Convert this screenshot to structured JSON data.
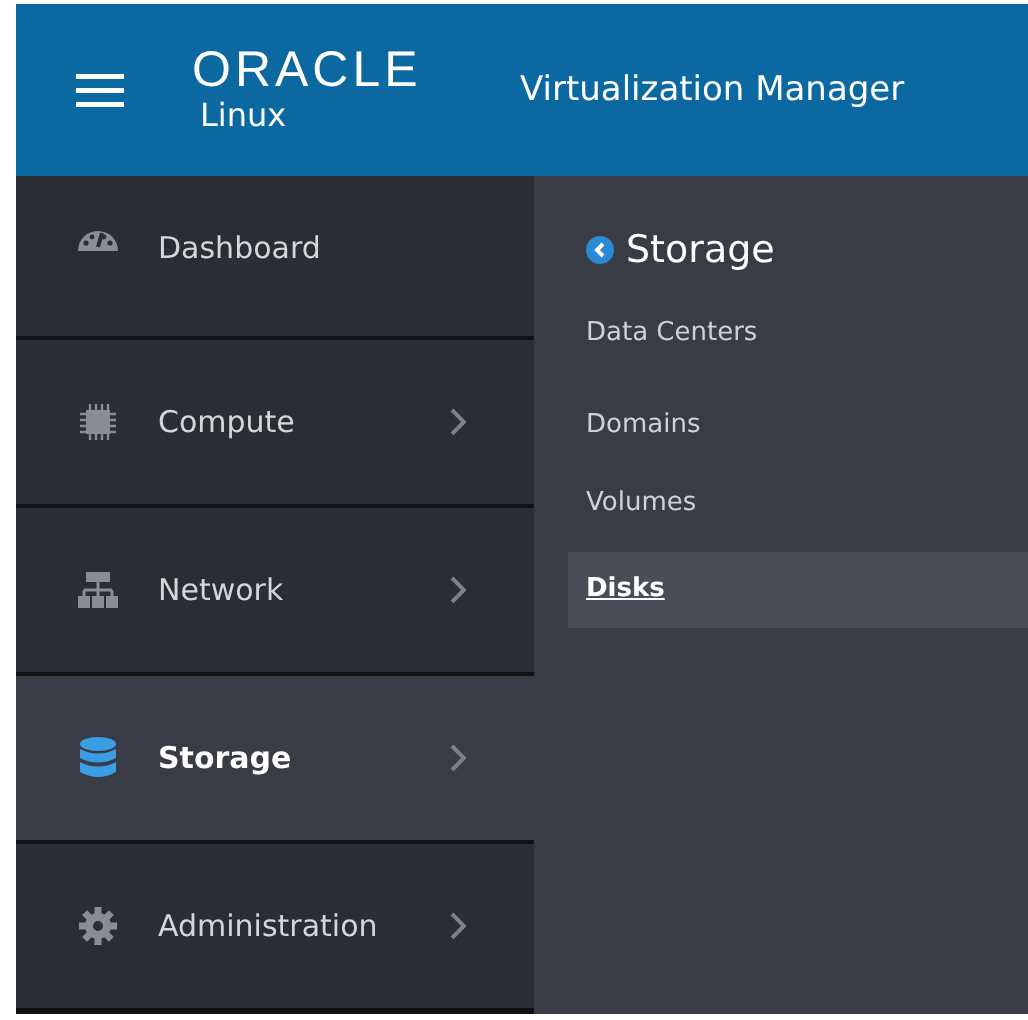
{
  "header": {
    "logo": "ORACLE",
    "logo_sub": "Linux",
    "title": "Virtualization Manager"
  },
  "sidebar": {
    "items": [
      {
        "label": "Dashboard",
        "has_submenu": false,
        "selected": false
      },
      {
        "label": "Compute",
        "has_submenu": true,
        "selected": false
      },
      {
        "label": "Network",
        "has_submenu": true,
        "selected": false
      },
      {
        "label": "Storage",
        "has_submenu": true,
        "selected": true
      },
      {
        "label": "Administration",
        "has_submenu": true,
        "selected": false
      }
    ]
  },
  "submenu": {
    "title": "Storage",
    "items": [
      {
        "label": "Data Centers",
        "selected": false
      },
      {
        "label": "Domains",
        "selected": false
      },
      {
        "label": "Volumes",
        "selected": false
      },
      {
        "label": "Disks",
        "selected": true
      }
    ]
  }
}
